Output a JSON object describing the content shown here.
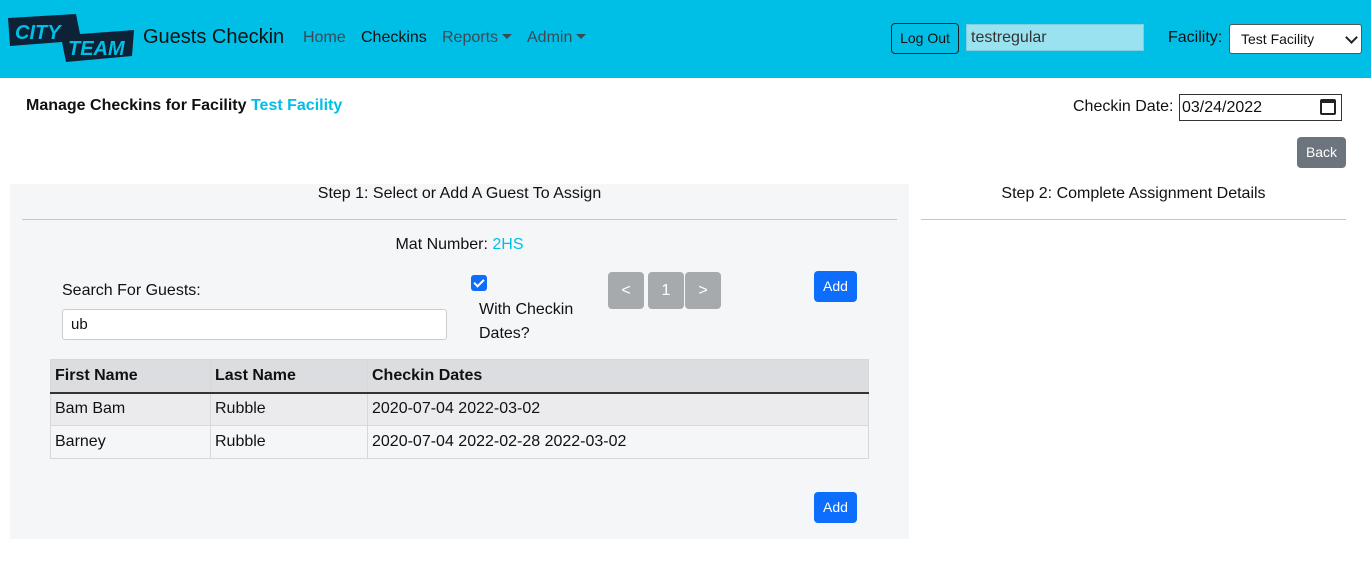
{
  "navbar": {
    "logo_text": "CITY TEAM",
    "brand": "Guests Checkin",
    "links": [
      {
        "label": "Home"
      },
      {
        "label": "Checkins"
      },
      {
        "label": "Reports"
      },
      {
        "label": "Admin"
      }
    ],
    "logout_label": "Log Out",
    "username": "testregular",
    "facility_label": "Facility:",
    "facility_selected": "Test Facility",
    "accent_color": "#00bfe7"
  },
  "header": {
    "title_prefix": "Manage Checkins for Facility",
    "title_facility": "Test Facility",
    "date_label": "Checkin Date:",
    "date_value": "03/24/2022",
    "back_label": "Back"
  },
  "step1": {
    "heading": "Step 1: Select or Add A Guest To Assign",
    "mat_label": "Mat Number:",
    "mat_number": "2HS",
    "search_label": "Search For Guests:",
    "search_value": "ub",
    "checkbox_label": "With Checkin Dates?",
    "checkbox_checked": true,
    "pager": {
      "prev": "<",
      "page": "1",
      "next": ">"
    },
    "add_label": "Add",
    "table": {
      "columns": [
        "First Name",
        "Last Name",
        "Checkin Dates"
      ],
      "rows": [
        [
          "Bam Bam",
          "Rubble",
          "2020-07-04 2022-03-02"
        ],
        [
          "Barney",
          "Rubble",
          "2020-07-04 2022-02-28 2022-03-02"
        ]
      ]
    }
  },
  "step2": {
    "heading": "Step 2: Complete Assignment Details"
  }
}
